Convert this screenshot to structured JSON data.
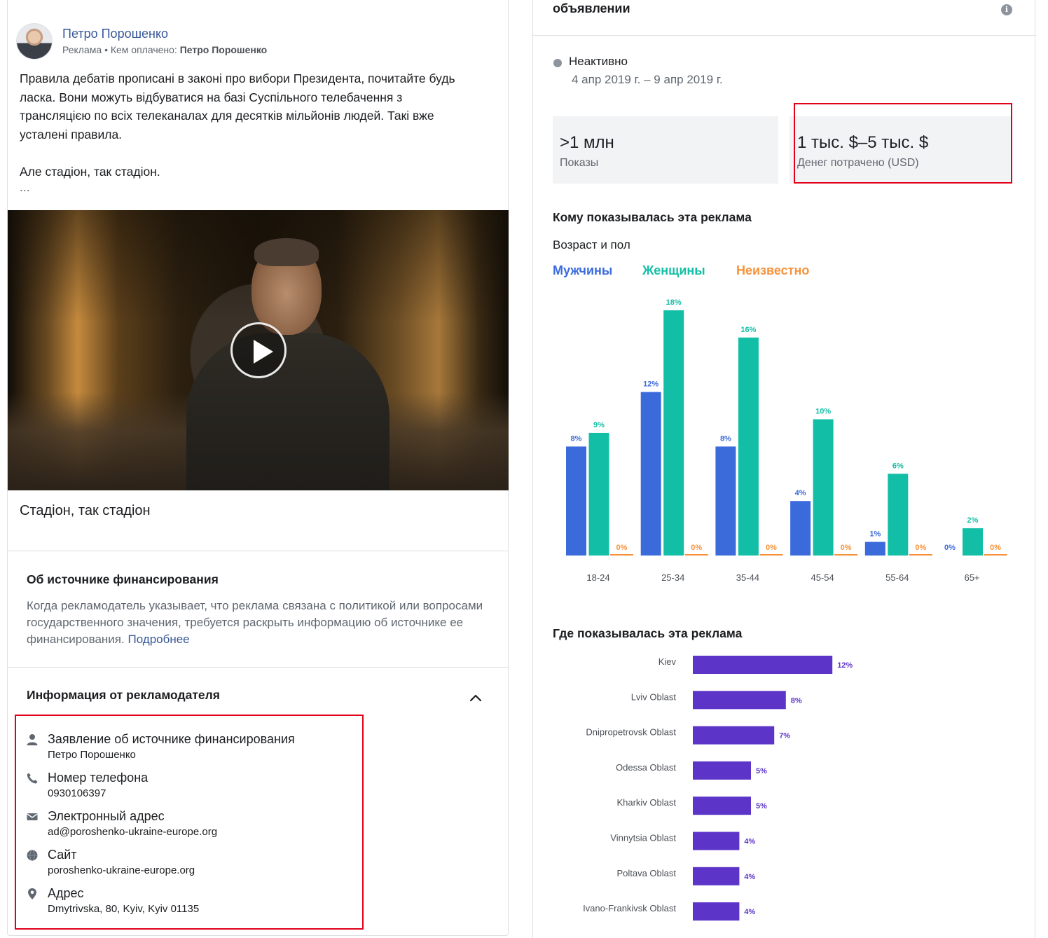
{
  "post": {
    "page_name": "Петро Порошенко",
    "sponsored_label": "Реклама",
    "paid_by_label": "• Кем оплачено: ",
    "paid_by_name": "Петро Порошенко",
    "text_lines": [
      "Правила дебатів прописані в законі про вибори Президента, почитайте будь",
      "ласка. Вони можуть відбуватися на базі Суспільного телебачення з",
      "трансляцією по всіх телеканалах для десятків мільйонів людей. Такі вже",
      "усталені правила."
    ],
    "text_line_2": "Але стадіон, так стадіон.",
    "ellipsis": "...",
    "video_caption": "Стадіон, так стадіон"
  },
  "funding": {
    "title": "Об источнике финансирования",
    "description": "Когда рекламодатель указывает, что реклама связана с политикой или вопросами государственного значения, требуется раскрыть информацию об источнике ее финансирования.",
    "more_link": "Подробнее"
  },
  "advertiser": {
    "title": "Информация от рекламодателя",
    "items": [
      {
        "icon": "person-icon",
        "label": "Заявление об источнике финансирования",
        "value": "Петро Порошенко"
      },
      {
        "icon": "phone-icon",
        "label": "Номер телефона",
        "value": "0930106397"
      },
      {
        "icon": "envelope-icon",
        "label": "Электронный адрес",
        "value": "ad@poroshenko-ukraine-europe.org"
      },
      {
        "icon": "globe-icon",
        "label": "Сайт",
        "value": "poroshenko-ukraine-europe.org"
      },
      {
        "icon": "location-pin-icon",
        "label": "Адрес",
        "value": "Dmytrivska, 80, Kyiv, Kyiv 01135"
      }
    ]
  },
  "ad_details": {
    "title_fragment": "объявлении",
    "status": "Неактивно",
    "date_range": "4 апр 2019 г. – 9 апр 2019 г.",
    "impressions_value": ">1 млн",
    "impressions_label": "Показы",
    "spend_value": "1 тыс. $–5 тыс. $",
    "spend_label": "Денег потрачено (USD)"
  },
  "audience": {
    "title": "Кому показывалась эта реклама",
    "age_gender_title": "Возраст и пол",
    "legend": [
      "Мужчины",
      "Женщины",
      "Неизвестно"
    ],
    "where_title": "Где показывалась эта реклама"
  },
  "colors": {
    "men": "#3b6bdb",
    "women": "#12bfa6",
    "unknown": "#f7923a",
    "region_bar": "#5c35c8",
    "highlight_red": "#e0001a",
    "link": "#385898"
  },
  "chart_data": [
    {
      "type": "bar",
      "title": "Возраст и пол",
      "categories": [
        "18-24",
        "25-34",
        "35-44",
        "45-54",
        "55-64",
        "65+"
      ],
      "series": [
        {
          "name": "Мужчины",
          "values": [
            8,
            12,
            8,
            4,
            1,
            0
          ]
        },
        {
          "name": "Женщины",
          "values": [
            9,
            18,
            16,
            10,
            6,
            2
          ]
        },
        {
          "name": "Неизвестно",
          "values": [
            0,
            0,
            0,
            0,
            0,
            0
          ]
        }
      ],
      "value_labels": [
        [
          "8%",
          "12%",
          "8%",
          "4%",
          "1%",
          "0%"
        ],
        [
          "9%",
          "18%",
          "16%",
          "10%",
          "6%",
          "2%"
        ],
        [
          "0%",
          "0%",
          "0%",
          "0%",
          "0%",
          "0%"
        ]
      ],
      "legend_position": "top-left",
      "ylim": [
        0,
        18
      ]
    },
    {
      "type": "bar",
      "orientation": "horizontal",
      "title": "Где показывалась эта реклама",
      "categories": [
        "Kiev",
        "Lviv Oblast",
        "Dnipropetrovsk Oblast",
        "Odessa Oblast",
        "Kharkiv Oblast",
        "Vinnytsia Oblast",
        "Poltava Oblast",
        "Ivano-Frankivsk Oblast"
      ],
      "values": [
        12,
        8,
        7,
        5,
        5,
        4,
        4,
        4
      ],
      "value_labels": [
        "12%",
        "8%",
        "7%",
        "5%",
        "5%",
        "4%",
        "4%",
        "4%"
      ]
    }
  ]
}
